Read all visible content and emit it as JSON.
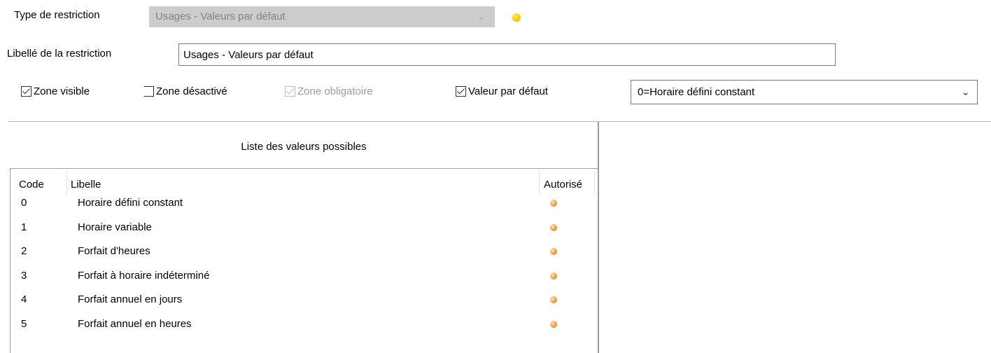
{
  "form": {
    "type_label": "Type de restriction",
    "type_value": "Usages - Valeurs par défaut",
    "libelle_label": "Libellé de la restriction",
    "libelle_value": "Usages - Valeurs par défaut"
  },
  "options": {
    "zone_visible": {
      "label": "Zone visible",
      "checked": true
    },
    "zone_desactive": {
      "label": "Zone désactivé",
      "checked": false
    },
    "zone_obligatoire": {
      "label": "Zone obligatoire",
      "checked": true,
      "disabled": true
    },
    "valeur_defaut": {
      "label": "Valeur par défaut",
      "checked": true
    },
    "default_select": "0=Horaire défini constant"
  },
  "list": {
    "title": "Liste des valeurs possibles",
    "columns": {
      "code": "Code",
      "libelle": "Libelle",
      "autorise": "Autorisé"
    },
    "rows": [
      {
        "code": "0",
        "libelle": "Horaire défini constant",
        "autorise": true
      },
      {
        "code": "1",
        "libelle": "Horaire variable",
        "autorise": true
      },
      {
        "code": "2",
        "libelle": "Forfait d'heures",
        "autorise": true
      },
      {
        "code": "3",
        "libelle": "Forfait à horaire indéterminé",
        "autorise": true
      },
      {
        "code": "4",
        "libelle": "Forfait annuel en jours",
        "autorise": true
      },
      {
        "code": "5",
        "libelle": "Forfait annuel en heures",
        "autorise": true
      }
    ]
  },
  "colors": {
    "status_dot": "#ffd200",
    "allowed_dot": "#f0a040"
  }
}
